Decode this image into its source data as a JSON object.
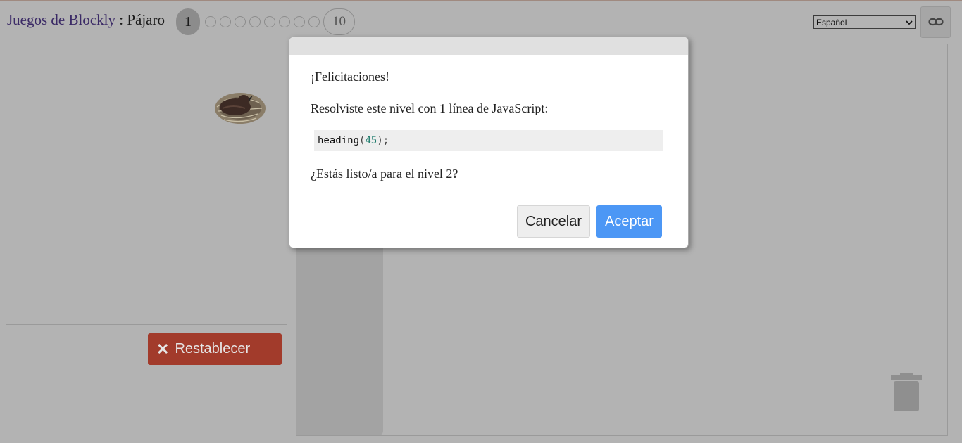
{
  "header": {
    "app_title": "Juegos de Blockly",
    "separator": " : ",
    "game_name": "Pájaro",
    "current_level": "1",
    "last_level": "10",
    "language": "Español"
  },
  "workspace": {
    "reset_label": "Restablecer"
  },
  "dialog": {
    "message1": "¡Felicitaciones!",
    "message2": "Resolviste este nivel con 1 línea de JavaScript:",
    "code_fn": "heading",
    "code_arg": "45",
    "message3": "¿Estás listo/a para el nivel 2?",
    "cancel_label": "Cancelar",
    "ok_label": "Aceptar"
  },
  "icons": {
    "link": "link-icon",
    "reset": "close-icon",
    "trash": "trash-icon",
    "bird": "bird-in-nest-icon"
  }
}
